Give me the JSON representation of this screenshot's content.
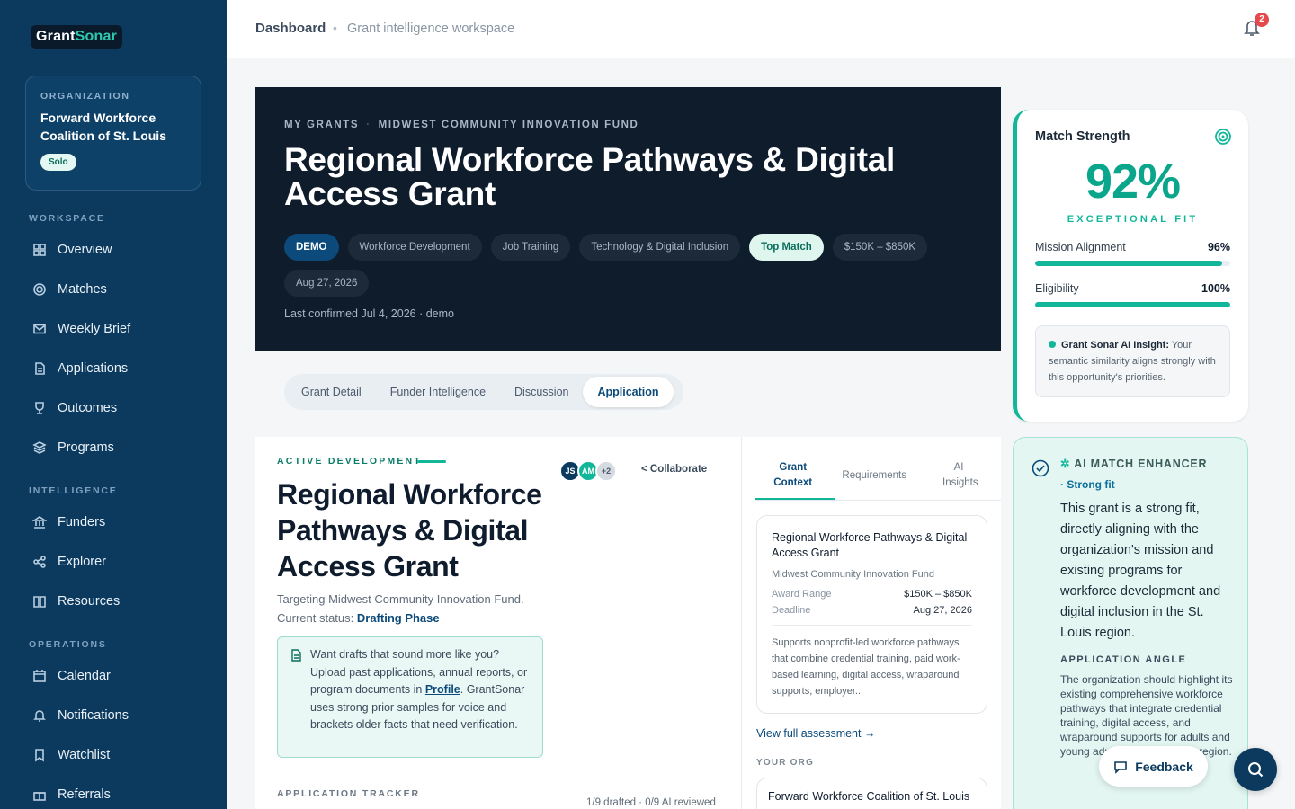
{
  "brand": {
    "part1": "Grant",
    "part2": "Sonar"
  },
  "org": {
    "label": "ORGANIZATION",
    "name": "Forward Workforce Coalition of St. Louis",
    "badge": "Solo"
  },
  "sidebar": {
    "workspace_label": "WORKSPACE",
    "intelligence_label": "INTELLIGENCE",
    "operations_label": "OPERATIONS",
    "items": [
      {
        "label": "Overview",
        "icon": "grid-icon"
      },
      {
        "label": "Matches",
        "icon": "target-icon"
      },
      {
        "label": "Weekly Brief",
        "icon": "mail-icon"
      },
      {
        "label": "Applications",
        "icon": "document-icon"
      },
      {
        "label": "Outcomes",
        "icon": "trophy-icon"
      },
      {
        "label": "Programs",
        "icon": "layers-icon"
      },
      {
        "label": "Funders",
        "icon": "bank-icon"
      },
      {
        "label": "Explorer",
        "icon": "share-icon"
      },
      {
        "label": "Resources",
        "icon": "book-icon"
      },
      {
        "label": "Calendar",
        "icon": "calendar-icon"
      },
      {
        "label": "Notifications",
        "icon": "bell-icon"
      },
      {
        "label": "Watchlist",
        "icon": "bookmark-icon"
      },
      {
        "label": "Referrals",
        "icon": "gift-icon"
      }
    ]
  },
  "header": {
    "crumb1": "Dashboard",
    "crumb2": "Grant intelligence workspace",
    "notifications": "2"
  },
  "hero": {
    "crumb1": "MY GRANTS",
    "crumb2": "MIDWEST COMMUNITY INNOVATION FUND",
    "title": "Regional Workforce Pathways & Digital Access Grant",
    "chips": [
      "DEMO",
      "Workforce Development",
      "Job Training",
      "Technology & Digital Inclusion",
      "Top Match",
      "$150K – $850K",
      "Aug 27, 2026"
    ],
    "confirmed": "Last confirmed Jul 4, 2026 · demo"
  },
  "tabs": [
    "Grant Detail",
    "Funder Intelligence",
    "Discussion",
    "Application"
  ],
  "match": {
    "title": "Match Strength",
    "pct": "92%",
    "fit": "EXCEPTIONAL FIT",
    "mission_label": "Mission Alignment",
    "mission_value": "96%",
    "mission_fraction": 0.96,
    "elig_label": "Eligibility",
    "elig_value": "100%",
    "elig_fraction": 1.0,
    "insight_title": "Grant Sonar AI Insight:",
    "insight_text": " Your semantic similarity aligns strongly with this opportunity's priorities."
  },
  "enhancer": {
    "title": "AI MATCH ENHANCER",
    "sub": "· Strong fit",
    "text": "This grant is a strong fit, directly aligning with the organization's mission and existing programs for workforce development and digital inclusion in the St. Louis region.",
    "angle_label": "APPLICATION ANGLE",
    "angle_text": "The organization should highlight its existing comprehensive workforce pathways that integrate credential training, digital access, and wraparound supports for adults and young adults in the St. Louis region."
  },
  "main": {
    "label": "ACTIVE DEVELOPMENT",
    "title": "Regional Workforce Pathways & Digital Access Grant",
    "targeting": "Targeting Midwest Community Innovation Fund.",
    "status_prefix": "Current status: ",
    "status": "Drafting Phase",
    "avatars": [
      "JS",
      "AM",
      "+2"
    ],
    "collaborate": "<  Collaborate",
    "tip_1": "Want drafts that sound more like you? Upload past applications, annual reports, or program documents in ",
    "tip_link": "Profile",
    "tip_2": ". GrantSonar uses strong prior samples for voice and brackets older facts that need verification.",
    "tracker_label": "APPLICATION TRACKER",
    "tracker_count": "1/9 drafted · 0/9 AI reviewed"
  },
  "side": {
    "tab1": "Grant Context",
    "tab2": "Requirements",
    "tab3": "AI Insights",
    "card_title": "Regional Workforce Pathways & Digital Access Grant",
    "card_funder": "Midwest Community Innovation Fund",
    "award_label": "Award Range",
    "award_value": "$150K – $850K",
    "deadline_label": "Deadline",
    "deadline_value": "Aug 27, 2026",
    "desc": "Supports nonprofit-led workforce pathways that combine credential training, paid work-based learning, digital access, wraparound supports, employer...",
    "view_link": "View full assessment →",
    "your_org": "YOUR ORG",
    "org_name": "Forward Workforce Coalition of St. Louis"
  },
  "feedback": "Feedback",
  "colors": {
    "sidebar": "#0b3a5e",
    "accent": "#12b79a",
    "hero": "#0f1c2b"
  }
}
